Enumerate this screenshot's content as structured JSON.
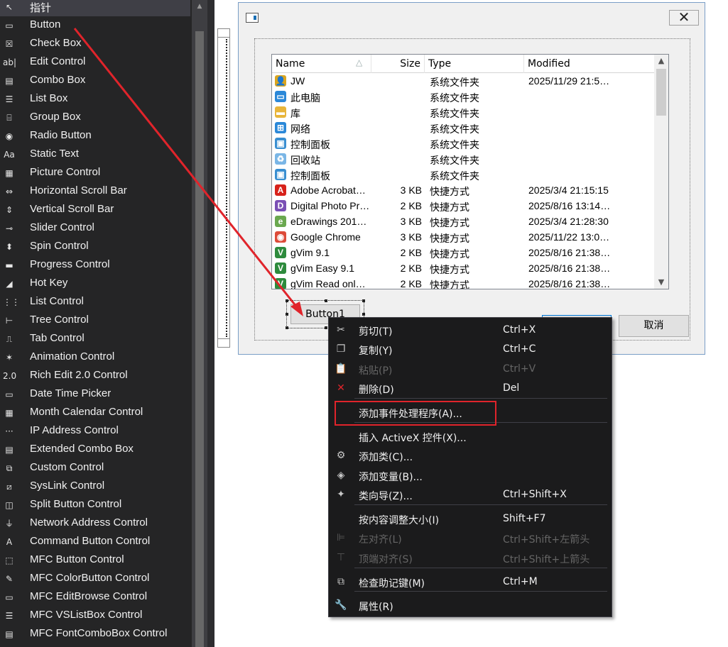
{
  "toolbox": {
    "items": [
      {
        "label": "指针",
        "icon": "pointer-icon",
        "glyph": "↖"
      },
      {
        "label": "Button",
        "icon": "button-icon",
        "glyph": "▭"
      },
      {
        "label": "Check Box",
        "icon": "check-box-icon",
        "glyph": "☒"
      },
      {
        "label": "Edit Control",
        "icon": "edit-control-icon",
        "glyph": "ab|"
      },
      {
        "label": "Combo Box",
        "icon": "combo-box-icon",
        "glyph": "▤"
      },
      {
        "label": "List Box",
        "icon": "list-box-icon",
        "glyph": "☰"
      },
      {
        "label": "Group Box",
        "icon": "group-box-icon",
        "glyph": "⌸"
      },
      {
        "label": "Radio Button",
        "icon": "radio-button-icon",
        "glyph": "◉"
      },
      {
        "label": "Static Text",
        "icon": "static-text-icon",
        "glyph": "Aa"
      },
      {
        "label": "Picture Control",
        "icon": "picture-control-icon",
        "glyph": "▦"
      },
      {
        "label": "Horizontal Scroll Bar",
        "icon": "horizontal-scroll-bar-icon",
        "glyph": "⇔"
      },
      {
        "label": "Vertical Scroll Bar",
        "icon": "vertical-scroll-bar-icon",
        "glyph": "⇕"
      },
      {
        "label": "Slider Control",
        "icon": "slider-control-icon",
        "glyph": "⊸"
      },
      {
        "label": "Spin Control",
        "icon": "spin-control-icon",
        "glyph": "⬍"
      },
      {
        "label": "Progress Control",
        "icon": "progress-control-icon",
        "glyph": "▬"
      },
      {
        "label": "Hot Key",
        "icon": "hot-key-icon",
        "glyph": "◢"
      },
      {
        "label": "List Control",
        "icon": "list-control-icon",
        "glyph": "⋮⋮"
      },
      {
        "label": "Tree Control",
        "icon": "tree-control-icon",
        "glyph": "⊢"
      },
      {
        "label": "Tab Control",
        "icon": "tab-control-icon",
        "glyph": "⎍"
      },
      {
        "label": "Animation Control",
        "icon": "animation-control-icon",
        "glyph": "✶"
      },
      {
        "label": "Rich Edit 2.0 Control",
        "icon": "rich-edit-icon",
        "glyph": "2.0"
      },
      {
        "label": "Date Time Picker",
        "icon": "date-time-picker-icon",
        "glyph": "▭"
      },
      {
        "label": "Month Calendar Control",
        "icon": "month-calendar-icon",
        "glyph": "▦"
      },
      {
        "label": "IP Address Control",
        "icon": "ip-address-icon",
        "glyph": "···"
      },
      {
        "label": "Extended Combo Box",
        "icon": "extended-combo-box-icon",
        "glyph": "▤"
      },
      {
        "label": "Custom Control",
        "icon": "custom-control-icon",
        "glyph": "⧉"
      },
      {
        "label": "SysLink Control",
        "icon": "syslink-control-icon",
        "glyph": "⧄"
      },
      {
        "label": "Split Button Control",
        "icon": "split-button-icon",
        "glyph": "◫"
      },
      {
        "label": "Network Address Control",
        "icon": "network-address-icon",
        "glyph": "⏚"
      },
      {
        "label": "Command Button Control",
        "icon": "command-button-icon",
        "glyph": "A"
      },
      {
        "label": "MFC Button Control",
        "icon": "mfc-button-icon",
        "glyph": "⬚"
      },
      {
        "label": "MFC ColorButton Control",
        "icon": "mfc-colorbutton-icon",
        "glyph": "✎"
      },
      {
        "label": "MFC EditBrowse Control",
        "icon": "mfc-editbrowse-icon",
        "glyph": "▭"
      },
      {
        "label": "MFC VSListBox Control",
        "icon": "mfc-vslistbox-icon",
        "glyph": "☰"
      },
      {
        "label": "MFC FontComboBox Control",
        "icon": "mfc-fontcombobox-icon",
        "glyph": "▤"
      }
    ]
  },
  "dialog": {
    "close_glyph": "✕",
    "button1_label": "Button1",
    "cancel_label": "取消"
  },
  "listview": {
    "columns": {
      "name": "Name",
      "size": "Size",
      "type": "Type",
      "modified": "Modified"
    },
    "rows": [
      {
        "name": "JW",
        "size": "",
        "type": "系统文件夹",
        "modified": "2025/11/29 21:5…",
        "icon": "user-folder-icon",
        "color": "#d9a521",
        "glyph": "👤"
      },
      {
        "name": "此电脑",
        "size": "",
        "type": "系统文件夹",
        "modified": "",
        "icon": "this-pc-icon",
        "color": "#2b88d8",
        "glyph": "▭"
      },
      {
        "name": "库",
        "size": "",
        "type": "系统文件夹",
        "modified": "",
        "icon": "library-folder-icon",
        "color": "#e8b53a",
        "glyph": "▬"
      },
      {
        "name": "网络",
        "size": "",
        "type": "系统文件夹",
        "modified": "",
        "icon": "network-icon",
        "color": "#2b88d8",
        "glyph": "⊞"
      },
      {
        "name": "控制面板",
        "size": "",
        "type": "系统文件夹",
        "modified": "",
        "icon": "control-panel-icon",
        "color": "#3a8fd1",
        "glyph": "▣"
      },
      {
        "name": "回收站",
        "size": "",
        "type": "系统文件夹",
        "modified": "",
        "icon": "recycle-bin-icon",
        "color": "#7ab6e6",
        "glyph": "♻"
      },
      {
        "name": "控制面板",
        "size": "",
        "type": "系统文件夹",
        "modified": "",
        "icon": "control-panel-icon",
        "color": "#3a8fd1",
        "glyph": "▣"
      },
      {
        "name": "Adobe Acrobat…",
        "size": "3 KB",
        "type": "快捷方式",
        "modified": "2025/3/4 21:15:15",
        "icon": "acrobat-icon",
        "color": "#d7221b",
        "glyph": "A"
      },
      {
        "name": "Digital Photo Pr…",
        "size": "2 KB",
        "type": "快捷方式",
        "modified": "2025/8/16 13:14…",
        "icon": "digital-photo-icon",
        "color": "#7a4fb5",
        "glyph": "D"
      },
      {
        "name": "eDrawings 201…",
        "size": "3 KB",
        "type": "快捷方式",
        "modified": "2025/3/4 21:28:30",
        "icon": "edrawings-icon",
        "color": "#6aa84f",
        "glyph": "e"
      },
      {
        "name": "Google Chrome",
        "size": "3 KB",
        "type": "快捷方式",
        "modified": "2025/11/22 13:0…",
        "icon": "chrome-icon",
        "color": "#dd4b39",
        "glyph": "◉"
      },
      {
        "name": "gVim 9.1",
        "size": "2 KB",
        "type": "快捷方式",
        "modified": "2025/8/16 21:38…",
        "icon": "gvim-icon",
        "color": "#2e8b3d",
        "glyph": "V"
      },
      {
        "name": "gVim Easy 9.1",
        "size": "2 KB",
        "type": "快捷方式",
        "modified": "2025/8/16 21:38…",
        "icon": "gvim-icon",
        "color": "#2e8b3d",
        "glyph": "V"
      },
      {
        "name": "gVim Read onl…",
        "size": "2 KB",
        "type": "快捷方式",
        "modified": "2025/8/16 21:38…",
        "icon": "gvim-icon",
        "color": "#2e8b3d",
        "glyph": "V"
      }
    ]
  },
  "context_menu": {
    "items": [
      {
        "label": "剪切(T)",
        "shortcut": "Ctrl+X",
        "icon": "cut-icon",
        "glyph": "✂",
        "disabled": false
      },
      {
        "label": "复制(Y)",
        "shortcut": "Ctrl+C",
        "icon": "copy-icon",
        "glyph": "❐",
        "disabled": false
      },
      {
        "label": "粘贴(P)",
        "shortcut": "Ctrl+V",
        "icon": "paste-icon",
        "glyph": "📋",
        "disabled": true
      },
      {
        "label": "删除(D)",
        "shortcut": "Del",
        "icon": "delete-icon",
        "glyph": "✕",
        "disabled": false
      },
      {
        "label": "添加事件处理程序(A)...",
        "shortcut": "",
        "icon": "",
        "glyph": "",
        "disabled": false
      },
      {
        "label": "插入 ActiveX 控件(X)...",
        "shortcut": "",
        "icon": "",
        "glyph": "",
        "disabled": false
      },
      {
        "label": "添加类(C)...",
        "shortcut": "",
        "icon": "add-class-icon",
        "glyph": "⚙",
        "disabled": false
      },
      {
        "label": "添加变量(B)...",
        "shortcut": "",
        "icon": "add-variable-icon",
        "glyph": "◈",
        "disabled": false
      },
      {
        "label": "类向导(Z)...",
        "shortcut": "Ctrl+Shift+X",
        "icon": "class-wizard-icon",
        "glyph": "✦",
        "disabled": false
      },
      {
        "label": "按内容调整大小(I)",
        "shortcut": "Shift+F7",
        "icon": "",
        "glyph": "",
        "disabled": false
      },
      {
        "label": "左对齐(L)",
        "shortcut": "Ctrl+Shift+左箭头",
        "icon": "align-left-icon",
        "glyph": "⊫",
        "disabled": true
      },
      {
        "label": "顶端对齐(S)",
        "shortcut": "Ctrl+Shift+上箭头",
        "icon": "align-top-icon",
        "glyph": "⊤",
        "disabled": true
      },
      {
        "label": "检查助记键(M)",
        "shortcut": "Ctrl+M",
        "icon": "check-mnemonics-icon",
        "glyph": "⧉",
        "disabled": false
      },
      {
        "label": "属性(R)",
        "shortcut": "",
        "icon": "properties-icon",
        "glyph": "🔧",
        "disabled": false
      }
    ]
  },
  "colors": {
    "annotation_red": "#e0242b",
    "toolbox_bg": "#252526",
    "menu_bg": "#1b1b1c"
  }
}
